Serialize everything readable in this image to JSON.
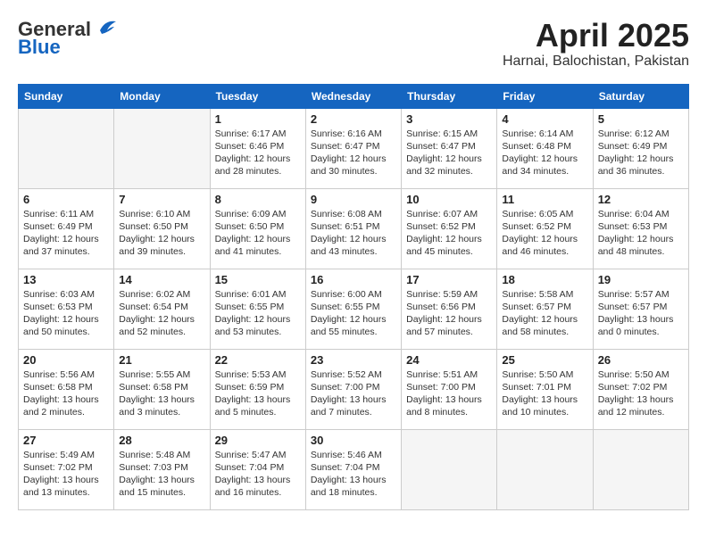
{
  "header": {
    "logo_general": "General",
    "logo_blue": "Blue",
    "month": "April 2025",
    "location": "Harnai, Balochistan, Pakistan"
  },
  "columns": [
    "Sunday",
    "Monday",
    "Tuesday",
    "Wednesday",
    "Thursday",
    "Friday",
    "Saturday"
  ],
  "weeks": [
    [
      {
        "day": "",
        "detail": ""
      },
      {
        "day": "",
        "detail": ""
      },
      {
        "day": "1",
        "detail": "Sunrise: 6:17 AM\nSunset: 6:46 PM\nDaylight: 12 hours\nand 28 minutes."
      },
      {
        "day": "2",
        "detail": "Sunrise: 6:16 AM\nSunset: 6:47 PM\nDaylight: 12 hours\nand 30 minutes."
      },
      {
        "day": "3",
        "detail": "Sunrise: 6:15 AM\nSunset: 6:47 PM\nDaylight: 12 hours\nand 32 minutes."
      },
      {
        "day": "4",
        "detail": "Sunrise: 6:14 AM\nSunset: 6:48 PM\nDaylight: 12 hours\nand 34 minutes."
      },
      {
        "day": "5",
        "detail": "Sunrise: 6:12 AM\nSunset: 6:49 PM\nDaylight: 12 hours\nand 36 minutes."
      }
    ],
    [
      {
        "day": "6",
        "detail": "Sunrise: 6:11 AM\nSunset: 6:49 PM\nDaylight: 12 hours\nand 37 minutes."
      },
      {
        "day": "7",
        "detail": "Sunrise: 6:10 AM\nSunset: 6:50 PM\nDaylight: 12 hours\nand 39 minutes."
      },
      {
        "day": "8",
        "detail": "Sunrise: 6:09 AM\nSunset: 6:50 PM\nDaylight: 12 hours\nand 41 minutes."
      },
      {
        "day": "9",
        "detail": "Sunrise: 6:08 AM\nSunset: 6:51 PM\nDaylight: 12 hours\nand 43 minutes."
      },
      {
        "day": "10",
        "detail": "Sunrise: 6:07 AM\nSunset: 6:52 PM\nDaylight: 12 hours\nand 45 minutes."
      },
      {
        "day": "11",
        "detail": "Sunrise: 6:05 AM\nSunset: 6:52 PM\nDaylight: 12 hours\nand 46 minutes."
      },
      {
        "day": "12",
        "detail": "Sunrise: 6:04 AM\nSunset: 6:53 PM\nDaylight: 12 hours\nand 48 minutes."
      }
    ],
    [
      {
        "day": "13",
        "detail": "Sunrise: 6:03 AM\nSunset: 6:53 PM\nDaylight: 12 hours\nand 50 minutes."
      },
      {
        "day": "14",
        "detail": "Sunrise: 6:02 AM\nSunset: 6:54 PM\nDaylight: 12 hours\nand 52 minutes."
      },
      {
        "day": "15",
        "detail": "Sunrise: 6:01 AM\nSunset: 6:55 PM\nDaylight: 12 hours\nand 53 minutes."
      },
      {
        "day": "16",
        "detail": "Sunrise: 6:00 AM\nSunset: 6:55 PM\nDaylight: 12 hours\nand 55 minutes."
      },
      {
        "day": "17",
        "detail": "Sunrise: 5:59 AM\nSunset: 6:56 PM\nDaylight: 12 hours\nand 57 minutes."
      },
      {
        "day": "18",
        "detail": "Sunrise: 5:58 AM\nSunset: 6:57 PM\nDaylight: 12 hours\nand 58 minutes."
      },
      {
        "day": "19",
        "detail": "Sunrise: 5:57 AM\nSunset: 6:57 PM\nDaylight: 13 hours\nand 0 minutes."
      }
    ],
    [
      {
        "day": "20",
        "detail": "Sunrise: 5:56 AM\nSunset: 6:58 PM\nDaylight: 13 hours\nand 2 minutes."
      },
      {
        "day": "21",
        "detail": "Sunrise: 5:55 AM\nSunset: 6:58 PM\nDaylight: 13 hours\nand 3 minutes."
      },
      {
        "day": "22",
        "detail": "Sunrise: 5:53 AM\nSunset: 6:59 PM\nDaylight: 13 hours\nand 5 minutes."
      },
      {
        "day": "23",
        "detail": "Sunrise: 5:52 AM\nSunset: 7:00 PM\nDaylight: 13 hours\nand 7 minutes."
      },
      {
        "day": "24",
        "detail": "Sunrise: 5:51 AM\nSunset: 7:00 PM\nDaylight: 13 hours\nand 8 minutes."
      },
      {
        "day": "25",
        "detail": "Sunrise: 5:50 AM\nSunset: 7:01 PM\nDaylight: 13 hours\nand 10 minutes."
      },
      {
        "day": "26",
        "detail": "Sunrise: 5:50 AM\nSunset: 7:02 PM\nDaylight: 13 hours\nand 12 minutes."
      }
    ],
    [
      {
        "day": "27",
        "detail": "Sunrise: 5:49 AM\nSunset: 7:02 PM\nDaylight: 13 hours\nand 13 minutes."
      },
      {
        "day": "28",
        "detail": "Sunrise: 5:48 AM\nSunset: 7:03 PM\nDaylight: 13 hours\nand 15 minutes."
      },
      {
        "day": "29",
        "detail": "Sunrise: 5:47 AM\nSunset: 7:04 PM\nDaylight: 13 hours\nand 16 minutes."
      },
      {
        "day": "30",
        "detail": "Sunrise: 5:46 AM\nSunset: 7:04 PM\nDaylight: 13 hours\nand 18 minutes."
      },
      {
        "day": "",
        "detail": ""
      },
      {
        "day": "",
        "detail": ""
      },
      {
        "day": "",
        "detail": ""
      }
    ]
  ]
}
